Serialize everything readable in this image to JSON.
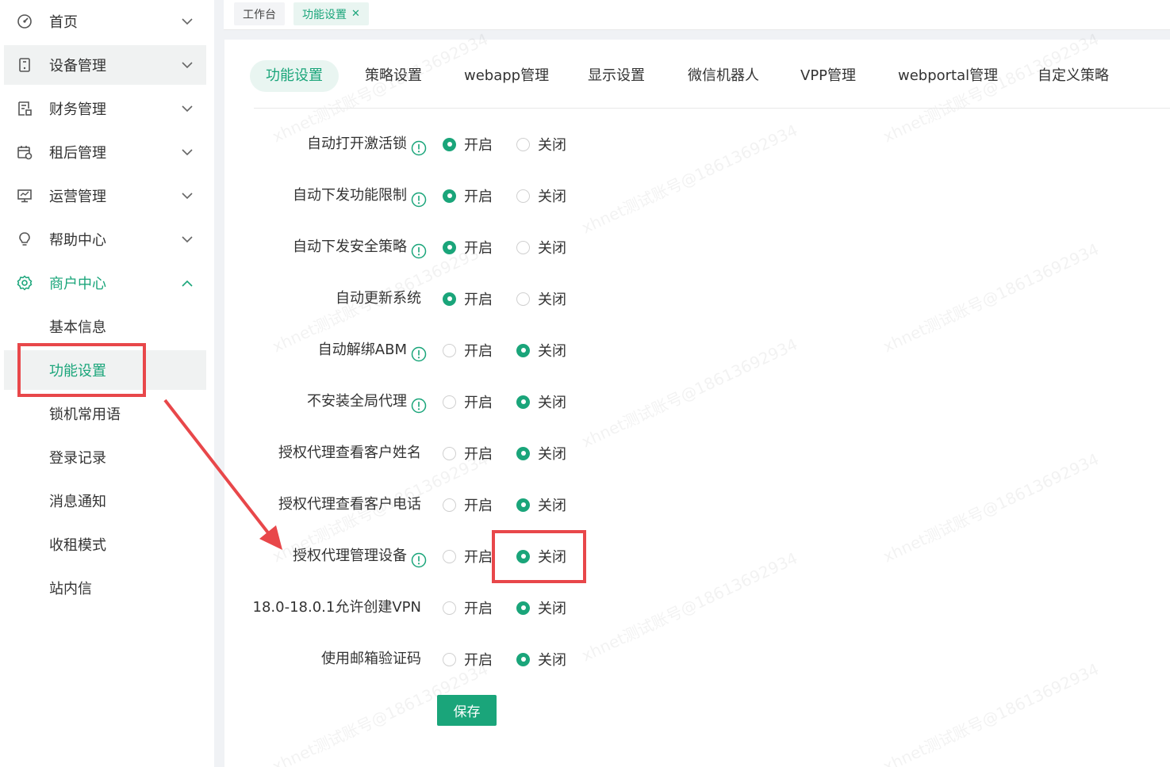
{
  "sidebar": {
    "menu": [
      {
        "label": "首页",
        "icon": "dashboard-icon"
      },
      {
        "label": "设备管理",
        "icon": "device-icon"
      },
      {
        "label": "财务管理",
        "icon": "finance-icon"
      },
      {
        "label": "租后管理",
        "icon": "calendar-icon"
      },
      {
        "label": "运营管理",
        "icon": "monitor-icon"
      },
      {
        "label": "帮助中心",
        "icon": "bulb-icon"
      },
      {
        "label": "商户中心",
        "icon": "gear-icon"
      }
    ],
    "submenu": [
      "基本信息",
      "功能设置",
      "锁机常用语",
      "登录记录",
      "消息通知",
      "收租模式",
      "站内信"
    ]
  },
  "page_tabs": [
    "工作台",
    "功能设置"
  ],
  "tabs": [
    "功能设置",
    "策略设置",
    "webapp管理",
    "显示设置",
    "微信机器人",
    "VPP管理",
    "webportal管理",
    "自定义策略"
  ],
  "radio_labels": {
    "on": "开启",
    "off": "关闭"
  },
  "settings": [
    {
      "label": "自动打开激活锁",
      "info": true,
      "value": "on"
    },
    {
      "label": "自动下发功能限制",
      "info": true,
      "value": "on"
    },
    {
      "label": "自动下发安全策略",
      "info": true,
      "value": "on"
    },
    {
      "label": "自动更新系统",
      "info": false,
      "value": "on"
    },
    {
      "label": "自动解绑ABM",
      "info": true,
      "value": "off"
    },
    {
      "label": "不安装全局代理",
      "info": true,
      "value": "off"
    },
    {
      "label": "授权代理查看客户姓名",
      "info": false,
      "value": "off"
    },
    {
      "label": "授权代理查看客户电话",
      "info": false,
      "value": "off"
    },
    {
      "label": "授权代理管理设备",
      "info": true,
      "value": "off"
    },
    {
      "label": "18.0-18.0.1允许创建VPN",
      "info": false,
      "value": "off"
    },
    {
      "label": "使用邮箱验证码",
      "info": false,
      "value": "off"
    }
  ],
  "save_label": "保存",
  "watermark": "xhnet测试账号@18613692934",
  "colors": {
    "accent": "#1aa57a",
    "annotation": "#e8474a"
  }
}
